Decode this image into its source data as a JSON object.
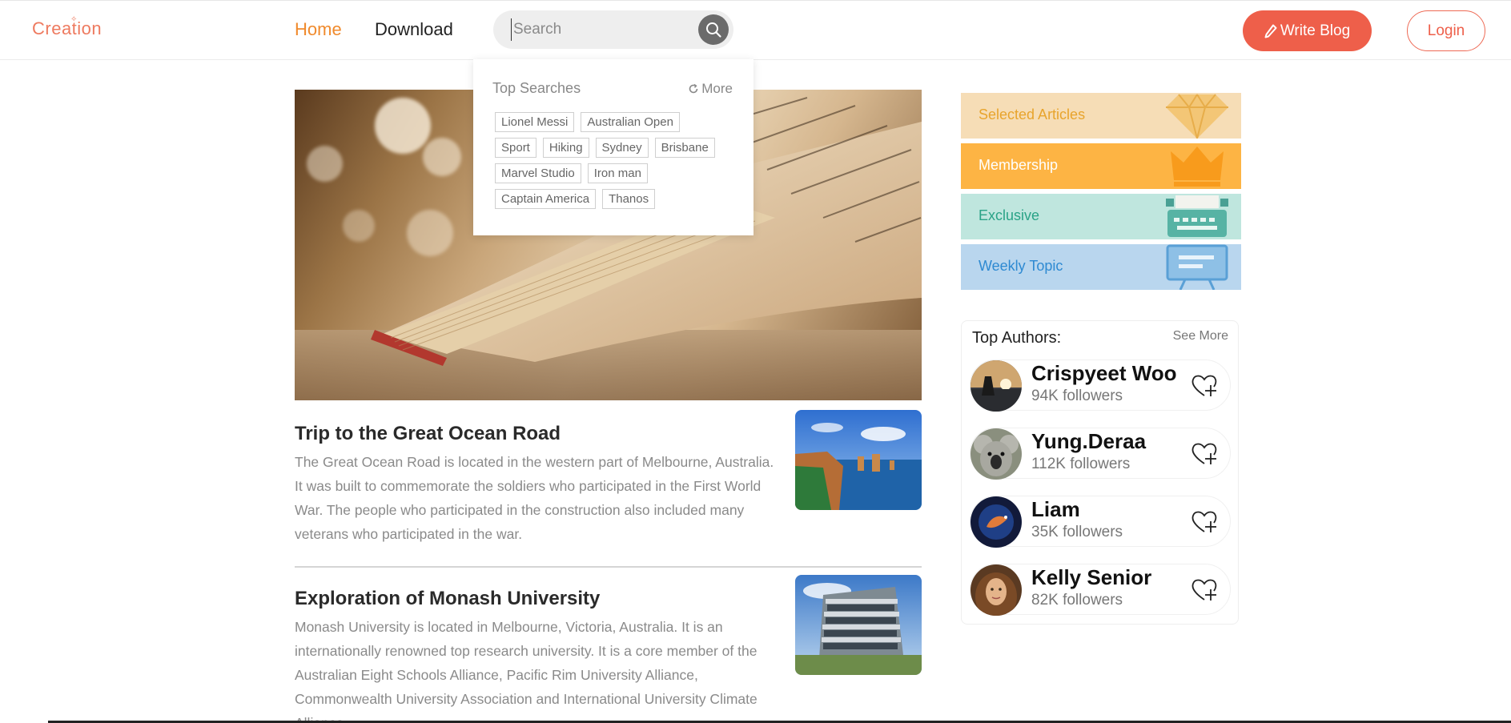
{
  "header": {
    "logo": "Creation",
    "nav": {
      "home": "Home",
      "download": "Download"
    },
    "search": {
      "placeholder": "Search",
      "icon": "search-icon"
    },
    "write_blog": "Write Blog",
    "login": "Login",
    "colors": {
      "accent": "#ee5f4a",
      "nav_active": "#f08a2c"
    }
  },
  "top_searches": {
    "title": "Top Searches",
    "more": "More",
    "rows": [
      [
        "Lionel Messi",
        "Australian Open"
      ],
      [
        "Sport",
        "Hiking",
        "Sydney",
        "Brisbane"
      ],
      [
        "Marvel Studio",
        "Iron man"
      ],
      [
        "Captain America",
        "Thanos"
      ]
    ]
  },
  "articles": [
    {
      "title": "Trip to the Great Ocean Road",
      "body": "The Great Ocean Road is located in the western part of Melbourne, Australia. It was built to commemorate the soldiers who participated in the First World War. The people who participated in the construction also included many veterans who participated in the war."
    },
    {
      "title": "Exploration of Monash University",
      "body": "Monash University is located in Melbourne, Victoria, Australia. It is an internationally renowned top research university. It is a core member of the Australian Eight Schools Alliance, Pacific Rim University Alliance, Commonwealth University Association and International University Climate Alliance."
    }
  ],
  "categories": [
    {
      "label": "Selected Articles",
      "bg": "#f6ddb6",
      "color": "#e8a42c",
      "icon": "diamond-icon"
    },
    {
      "label": "Membership",
      "bg": "#fdb444",
      "color": "#ffffff",
      "icon": "crown-icon"
    },
    {
      "label": "Exclusive",
      "bg": "#bfe6de",
      "color": "#2aa387",
      "icon": "typewriter-icon"
    },
    {
      "label": "Weekly Topic",
      "bg": "#b9d6ee",
      "color": "#2e8ad2",
      "icon": "presentation-board-icon"
    }
  ],
  "top_authors": {
    "title": "Top Authors:",
    "more": "See More",
    "list": [
      {
        "name": "Crispyeet Woo",
        "followers": "94K followers"
      },
      {
        "name": "Yung.Deraa",
        "followers": "112K followers"
      },
      {
        "name": "Liam",
        "followers": "35K followers"
      },
      {
        "name": "Kelly Senior",
        "followers": "82K followers"
      }
    ]
  }
}
